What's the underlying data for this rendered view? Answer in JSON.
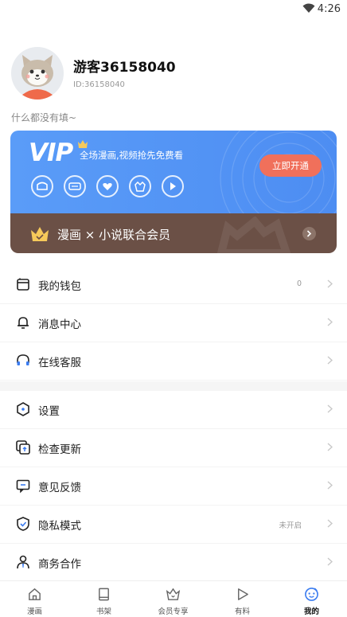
{
  "status_bar": {
    "time": "4:26"
  },
  "profile": {
    "username": "游客36158040",
    "user_id": "ID:36158040",
    "bio": "什么都没有填~"
  },
  "vip": {
    "logo": "VIP",
    "description": "全场漫画,视频抢先免费看",
    "open_button": "立即开通",
    "icons": [
      "mask-icon",
      "ad-free-icon",
      "heart-icon",
      "crown-flag-icon",
      "play-icon"
    ]
  },
  "combo": {
    "label": "漫画 × 小说联合会员"
  },
  "menu_group_1": [
    {
      "label": "我的钱包",
      "value": "0",
      "icon": "wallet-icon"
    },
    {
      "label": "消息中心",
      "value": "",
      "icon": "bell-icon"
    },
    {
      "label": "在线客服",
      "value": "",
      "icon": "headset-icon"
    }
  ],
  "menu_group_2": [
    {
      "label": "设置",
      "value": "",
      "icon": "settings-hexagon-icon"
    },
    {
      "label": "检查更新",
      "value": "",
      "icon": "update-icon"
    },
    {
      "label": "意见反馈",
      "value": "",
      "icon": "feedback-icon"
    },
    {
      "label": "隐私模式",
      "value": "未开启",
      "icon": "shield-check-icon"
    },
    {
      "label": "商务合作",
      "value": "",
      "icon": "business-person-icon"
    }
  ],
  "bottom_nav": [
    {
      "label": "漫画",
      "icon": "home-icon",
      "active": false
    },
    {
      "label": "书架",
      "icon": "bookshelf-icon",
      "active": false
    },
    {
      "label": "会员专享",
      "icon": "member-crown-icon",
      "active": false
    },
    {
      "label": "有料",
      "icon": "play-tab-icon",
      "active": false
    },
    {
      "label": "我的",
      "icon": "me-face-icon",
      "active": true
    }
  ],
  "colors": {
    "vip_blue": "#5a9cf8",
    "open_button": "#f0705b",
    "combo_brown": "#6b5046",
    "crown_gold": "#f6c95a",
    "accent_blue": "#3b7cf0"
  }
}
